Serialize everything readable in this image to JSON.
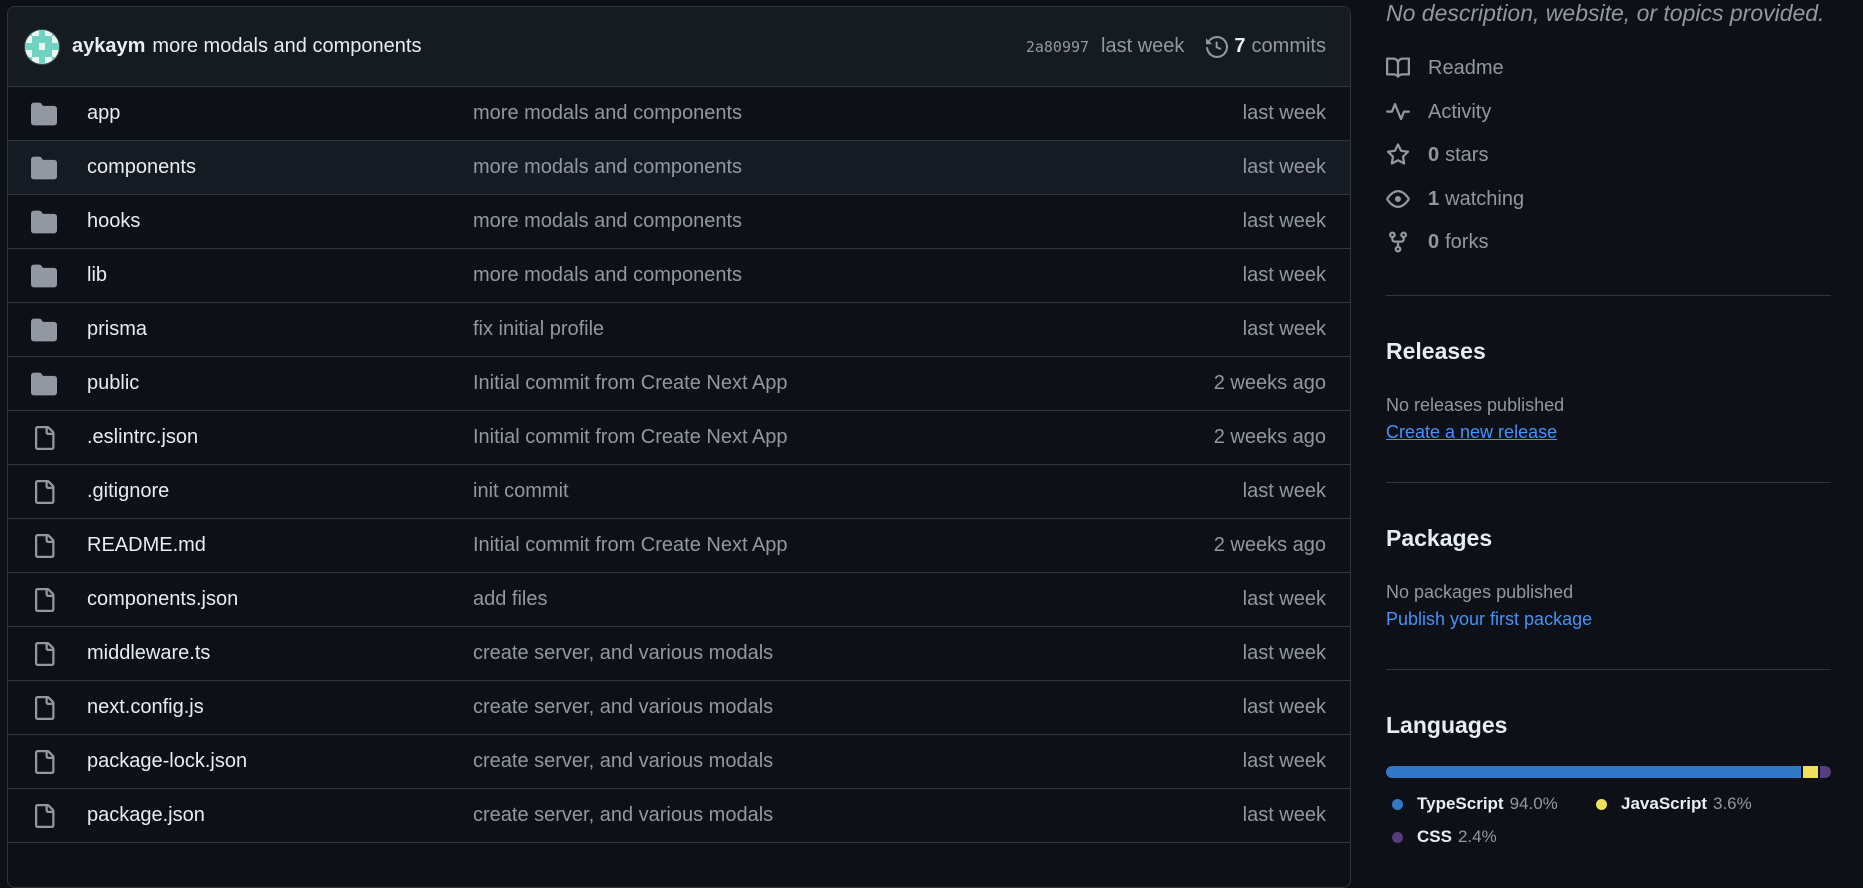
{
  "commit": {
    "author": "aykaym",
    "message": "more modals and components",
    "sha": "2a80997",
    "time": "last week",
    "count": "7",
    "count_label": "commits"
  },
  "files": [
    {
      "type": "folder",
      "name": "app",
      "message": "more modals and components",
      "time": "last week"
    },
    {
      "type": "folder",
      "name": "components",
      "message": "more modals and components",
      "time": "last week"
    },
    {
      "type": "folder",
      "name": "hooks",
      "message": "more modals and components",
      "time": "last week"
    },
    {
      "type": "folder",
      "name": "lib",
      "message": "more modals and components",
      "time": "last week"
    },
    {
      "type": "folder",
      "name": "prisma",
      "message": "fix initial profile",
      "time": "last week"
    },
    {
      "type": "folder",
      "name": "public",
      "message": "Initial commit from Create Next App",
      "time": "2 weeks ago"
    },
    {
      "type": "file",
      "name": ".eslintrc.json",
      "message": "Initial commit from Create Next App",
      "time": "2 weeks ago"
    },
    {
      "type": "file",
      "name": ".gitignore",
      "message": "init commit",
      "time": "last week"
    },
    {
      "type": "file",
      "name": "README.md",
      "message": "Initial commit from Create Next App",
      "time": "2 weeks ago"
    },
    {
      "type": "file",
      "name": "components.json",
      "message": "add files",
      "time": "last week"
    },
    {
      "type": "file",
      "name": "middleware.ts",
      "message": "create server, and various modals",
      "time": "last week"
    },
    {
      "type": "file",
      "name": "next.config.js",
      "message": "create server, and various modals",
      "time": "last week"
    },
    {
      "type": "file",
      "name": "package-lock.json",
      "message": "create server, and various modals",
      "time": "last week"
    },
    {
      "type": "file",
      "name": "package.json",
      "message": "create server, and various modals",
      "time": "last week"
    }
  ],
  "about": {
    "description": "No description, website, or topics provided.",
    "readme": "Readme",
    "activity": "Activity",
    "stars_count": "0",
    "stars_label": "stars",
    "watching_count": "1",
    "watching_label": "watching",
    "forks_count": "0",
    "forks_label": "forks"
  },
  "releases": {
    "title": "Releases",
    "text": "No releases published",
    "link": "Create a new release"
  },
  "packages": {
    "title": "Packages",
    "text": "No packages published",
    "link": "Publish your first package"
  },
  "languages": {
    "title": "Languages",
    "items": [
      {
        "name": "TypeScript",
        "percent": "94.0%",
        "value": 94.0,
        "color": "#3178c6"
      },
      {
        "name": "JavaScript",
        "percent": "3.6%",
        "value": 3.6,
        "color": "#f1e05a"
      },
      {
        "name": "CSS",
        "percent": "2.4%",
        "value": 2.4,
        "color": "#563d7c"
      }
    ]
  },
  "colors": {
    "background": "#0d1117",
    "header": "#161b22",
    "border": "#30363d",
    "muted": "#9198a1",
    "link": "#4493f8"
  },
  "icons": {
    "folder": "folder-icon",
    "file": "file-icon",
    "history": "history-icon"
  }
}
